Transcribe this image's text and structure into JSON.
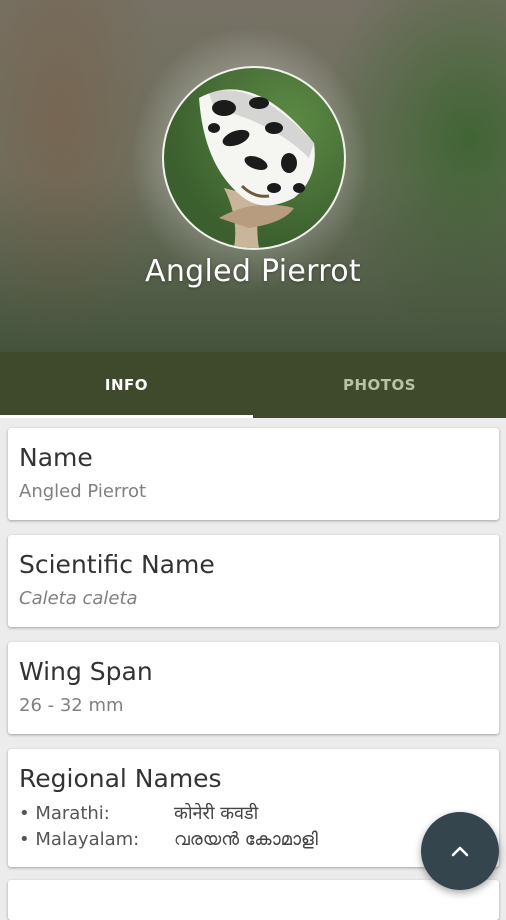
{
  "species": {
    "title": "Angled Pierrot"
  },
  "tabs": [
    {
      "label": "INFO",
      "active": true
    },
    {
      "label": "PHOTOS",
      "active": false
    }
  ],
  "cards": {
    "name": {
      "title": "Name",
      "value": "Angled Pierrot"
    },
    "scientific_name": {
      "title": "Scientific Name",
      "value": "Caleta caleta"
    },
    "wing_span": {
      "title": "Wing Span",
      "value": "26 - 32 mm"
    },
    "regional_names": {
      "title": "Regional Names",
      "items": [
        {
          "language": "• Marathi:",
          "name": "कोनेरी कवडी"
        },
        {
          "language": "• Malayalam:",
          "name": "വരയൻ കോമാളി"
        }
      ]
    }
  },
  "fab": {
    "icon": "chevron-up-icon"
  },
  "colors": {
    "tab_bar": "#3f4a2c",
    "fab": "#34454d",
    "background": "#ececec"
  }
}
